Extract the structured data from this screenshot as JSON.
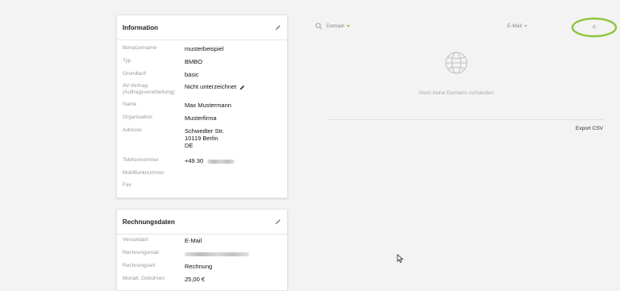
{
  "info": {
    "title": "Information",
    "rows": [
      {
        "label": "Benutzername",
        "value": "musterbeispiel"
      },
      {
        "label": "Typ",
        "value": "BMBO"
      },
      {
        "label": "Grundtarif",
        "value": "basic"
      },
      {
        "label": "AV-Vertrag\n(Auftragsverarbeitung)",
        "value": "Nicht unterzeichnet"
      },
      {
        "label": "Name",
        "value": "Max Mustermann"
      },
      {
        "label": "Organisation",
        "value": "Musterfirma"
      },
      {
        "label": "Adresse",
        "value": "Schwedter Str.\n10119 Berlin\nDE"
      },
      {
        "label": "Telefonnummer",
        "value": "+49 30"
      },
      {
        "label": "Mobilfunknummer",
        "value": ""
      },
      {
        "label": "Fax",
        "value": ""
      }
    ]
  },
  "billing": {
    "title": "Rechnungsdaten",
    "rows": [
      {
        "label": "Versandart",
        "value": "E-Mail"
      },
      {
        "label": "Rechnungsmail",
        "value": ""
      },
      {
        "label": "Rechnungsart",
        "value": "Rechnung"
      },
      {
        "label": "Monatl. Gebühren",
        "value": "25,00 €"
      }
    ]
  },
  "domains": {
    "filter_label": "Domain",
    "email_filter_label": "E-Mail",
    "add_label": "+",
    "empty_text": "Noch keine Domains vorhanden",
    "export_label": "Export CSV"
  },
  "colors": {
    "accent_green": "#8cc63f",
    "annotation_green": "#8dc63f"
  }
}
